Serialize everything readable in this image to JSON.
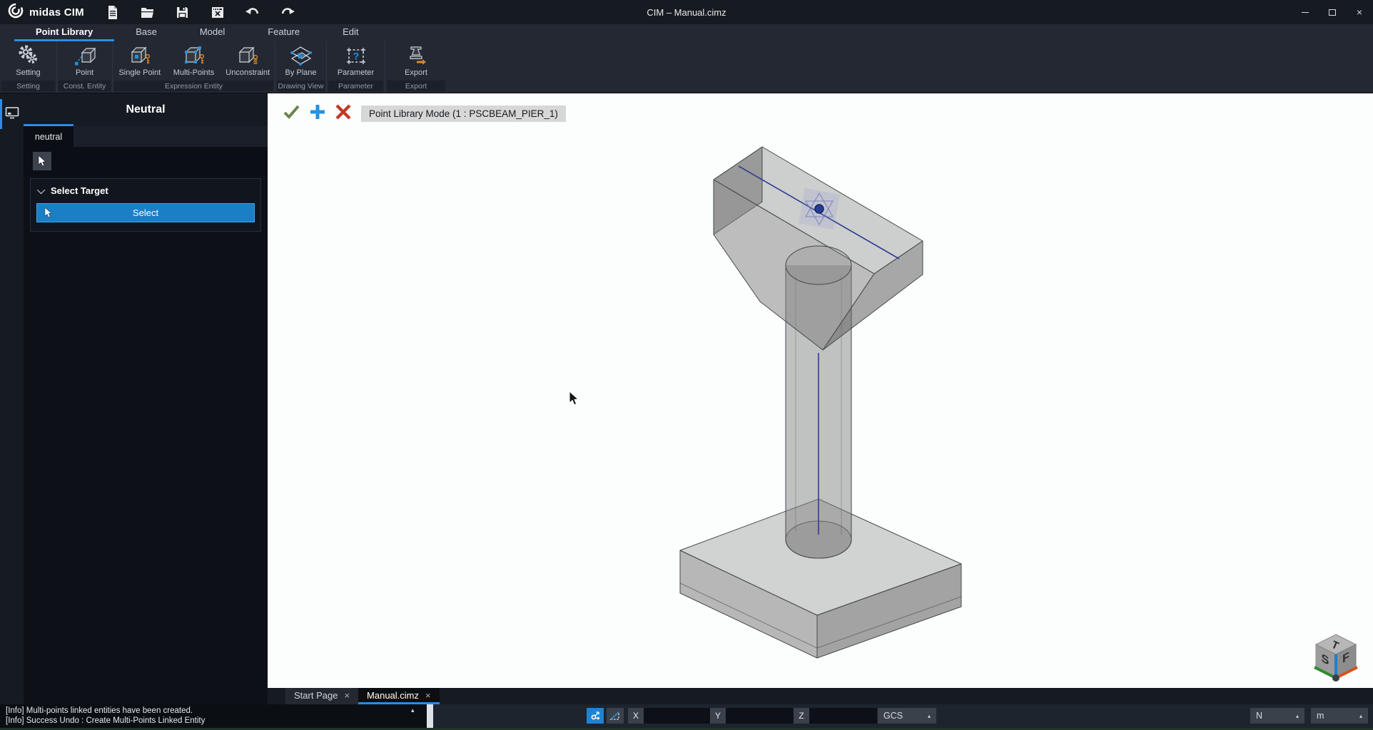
{
  "titlebar": {
    "app_name": "midas CIM",
    "window_title": "CIM – Manual.cimz"
  },
  "glyphs": {
    "close": "×",
    "minimize": "–",
    "caret_up": "▴"
  },
  "menu_tabs": [
    {
      "label": "Point Library",
      "active": true
    },
    {
      "label": "Base",
      "active": false
    },
    {
      "label": "Model",
      "active": false
    },
    {
      "label": "Feature",
      "active": false
    },
    {
      "label": "Edit",
      "active": false
    }
  ],
  "ribbon": {
    "buttons": [
      {
        "label": "Setting"
      },
      {
        "label": "Point"
      },
      {
        "label": "Single Point"
      },
      {
        "label": "Multi-Points"
      },
      {
        "label": "Unconstraint"
      },
      {
        "label": "By Plane"
      },
      {
        "label": "Parameter"
      },
      {
        "label": "Export"
      }
    ],
    "groups": [
      {
        "label": "Setting"
      },
      {
        "label": "Const. Entity"
      },
      {
        "label": "Expression Entity"
      },
      {
        "label": "Drawing View"
      },
      {
        "label": "Parameter"
      },
      {
        "label": "Export"
      }
    ]
  },
  "left_panel": {
    "title": "Neutral",
    "tab_label": "neutral",
    "section_title": "Select Target",
    "select_button_label": "Select"
  },
  "viewport": {
    "mode_label": "Point Library Mode (1 : PSCBEAM_PIER_1)"
  },
  "doc_tabs": [
    {
      "label": "Start Page",
      "active": false
    },
    {
      "label": "Manual.cimz",
      "active": true
    }
  ],
  "status": {
    "messages": [
      "[Info] Multi-points linked entities have been created.",
      "[Info] Success Undo : Create Multi-Points Linked Entity"
    ],
    "x_label": "X",
    "x_value": "",
    "y_label": "Y",
    "y_value": "",
    "z_label": "Z",
    "z_value": "",
    "cs_selector": "GCS",
    "force_unit": "N",
    "length_unit": "m"
  },
  "view_cube": {
    "top": "T",
    "left": "S",
    "front": "F"
  },
  "colors": {
    "accent": "#2a8ceb",
    "select_button": "#1b7fc6",
    "confirm_check": "#6d8449",
    "add_plus": "#2492e0",
    "cancel_cross": "#c03a28"
  }
}
